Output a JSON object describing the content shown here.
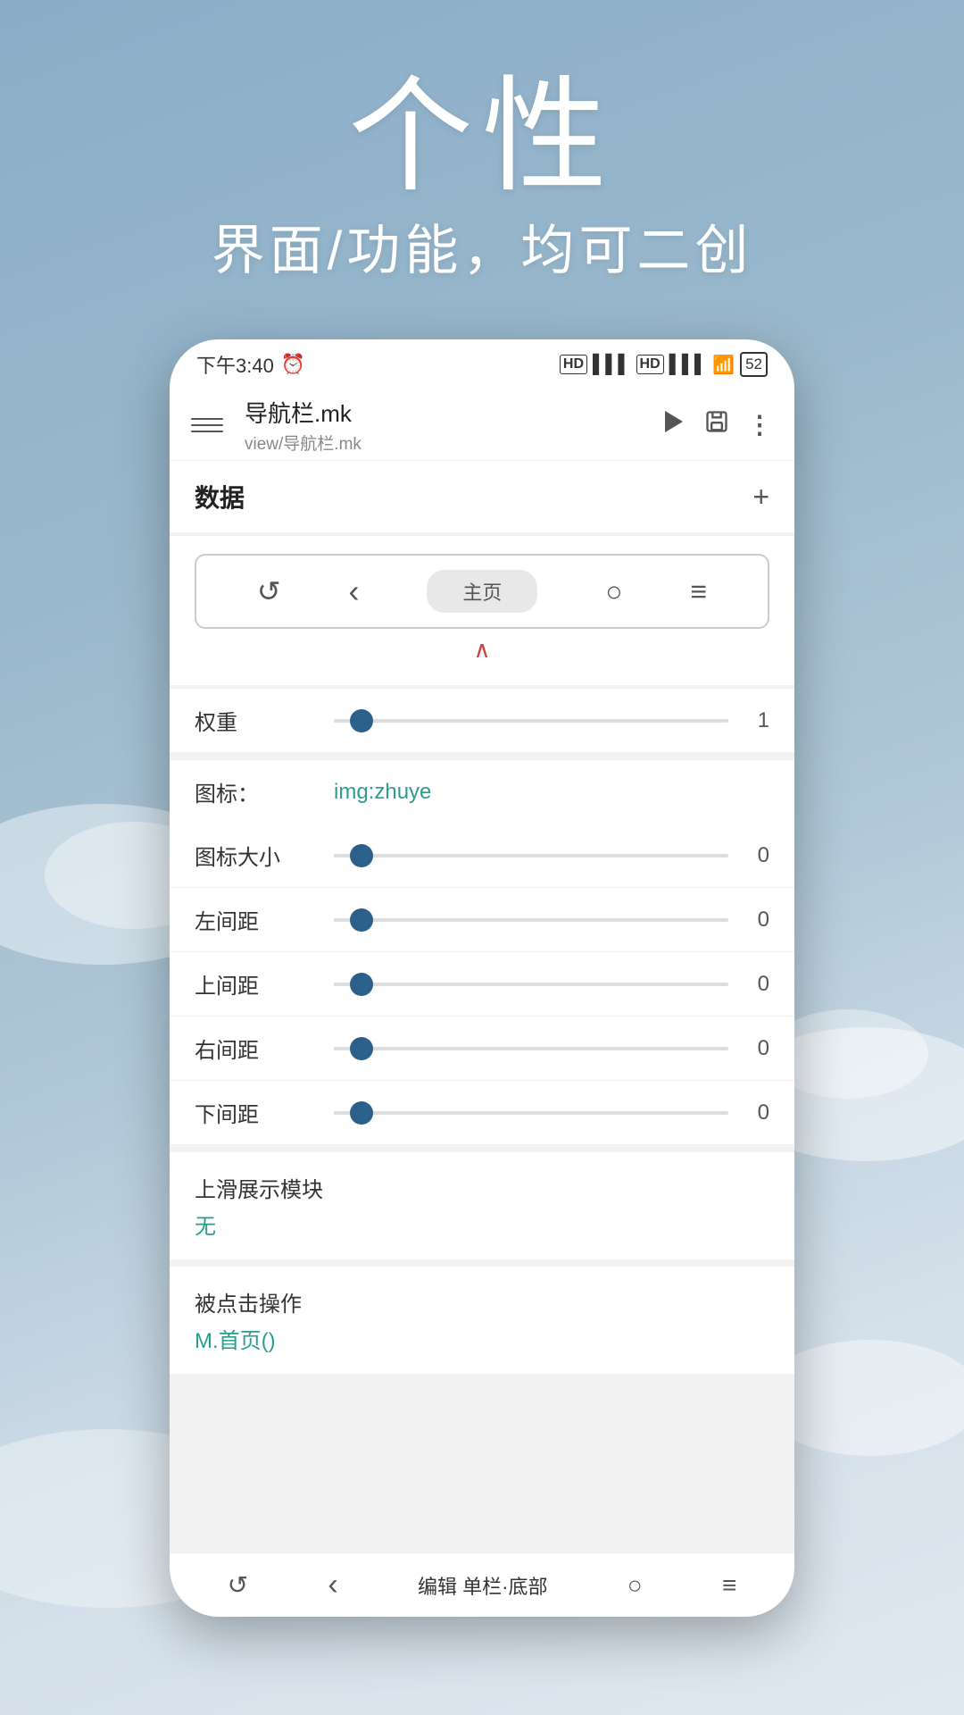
{
  "background": {
    "gradient_start": "#8aaec8",
    "gradient_end": "#e0e8f0"
  },
  "top_text": {
    "title_big": "个性",
    "title_sub": "界面/功能，均可二创"
  },
  "status_bar": {
    "time": "下午3:40",
    "alarm_icon": "⏰",
    "signal1": "HD",
    "signal2": "HD",
    "wifi": "WiFi",
    "battery": "52"
  },
  "app_header": {
    "title": "导航栏.mk",
    "subtitle": "view/导航栏.mk",
    "menu_label": "Menu",
    "play_label": "Play",
    "save_label": "Save",
    "more_label": "More"
  },
  "data_section": {
    "title": "数据",
    "add_label": "+"
  },
  "nav_bar_preview": {
    "back_icon": "‹",
    "home_label": "主页",
    "circle_icon": "○",
    "menu_icon": "≡",
    "reload_icon": "↺"
  },
  "collapse_arrow": "∧",
  "properties": {
    "weight_label": "权重",
    "weight_value": "1",
    "weight_thumb_pct": 4,
    "icon_label": "图标：",
    "icon_value": "img:zhuye",
    "icon_size_label": "图标大小",
    "icon_size_value": "0",
    "icon_size_thumb_pct": 4,
    "left_margin_label": "左间距",
    "left_margin_value": "0",
    "left_margin_thumb_pct": 4,
    "top_margin_label": "上间距",
    "top_margin_value": "0",
    "top_margin_thumb_pct": 4,
    "right_margin_label": "右间距",
    "right_margin_value": "0",
    "right_margin_thumb_pct": 4,
    "bottom_margin_label": "下间距",
    "bottom_margin_value": "0",
    "bottom_margin_thumb_pct": 4,
    "slide_module_label": "上滑展示模块",
    "slide_module_value": "无",
    "click_action_label": "被点击操作",
    "click_action_value": "M.首页()"
  },
  "bottom_nav": {
    "nav1_icon": "↺",
    "nav2_icon": "‹",
    "nav_label": "编辑 单栏·底部",
    "nav3_icon": "○",
    "nav4_icon": "≡"
  }
}
